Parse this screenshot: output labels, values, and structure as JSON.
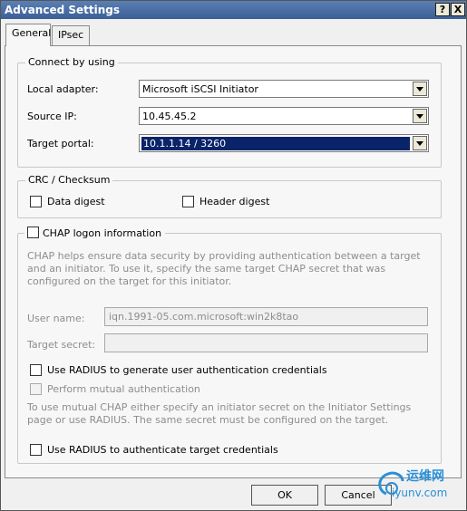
{
  "window": {
    "title": "Advanced Settings",
    "help_glyph": "?",
    "close_glyph": "X"
  },
  "tabs": [
    {
      "label": "General",
      "active": true
    },
    {
      "label": "IPsec",
      "active": false
    }
  ],
  "connect": {
    "legend": "Connect by using",
    "local_adapter_label": "Local adapter:",
    "local_adapter_value": "Microsoft iSCSI Initiator",
    "source_ip_label": "Source IP:",
    "source_ip_value": "10.45.45.2",
    "target_portal_label": "Target portal:",
    "target_portal_value": "10.1.1.14 / 3260"
  },
  "crc": {
    "legend": "CRC / Checksum",
    "data_digest": "Data digest",
    "header_digest": "Header digest"
  },
  "chap": {
    "legend_label": "CHAP logon information",
    "description": "CHAP helps ensure data security by providing authentication between a target and an initiator. To use it, specify the same target CHAP secret that was configured on the target for this initiator.",
    "username_label": "User name:",
    "username_value": "iqn.1991-05.com.microsoft:win2k8tao",
    "secret_label": "Target secret:",
    "secret_value": "",
    "radius_gen": "Use RADIUS to generate user authentication credentials",
    "mutual": "Perform mutual authentication",
    "mutual_desc": "To use mutual CHAP either specify an initiator secret on the Initiator Settings page or use RADIUS.  The same secret must be configured on the target.",
    "radius_auth": "Use RADIUS to authenticate target credentials"
  },
  "buttons": {
    "ok": "OK",
    "cancel": "Cancel"
  },
  "watermark": {
    "text_top": "运维网",
    "text_bottom": "iyunv.com"
  },
  "colors": {
    "titlebar": "#3b5f96",
    "selection": "#0a246a",
    "watermark": "#2a8fd6"
  }
}
